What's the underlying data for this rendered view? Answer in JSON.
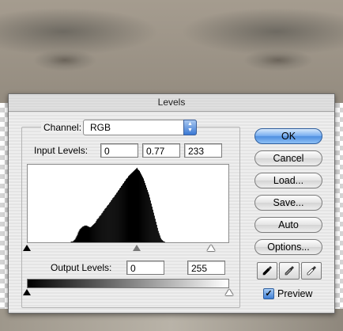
{
  "dialog": {
    "title": "Levels",
    "channel_label": "Channel:",
    "channel_value": "RGB",
    "input_levels_label": "Input Levels:",
    "input_black": "0",
    "input_gamma": "0.77",
    "input_white": "233",
    "output_levels_label": "Output Levels:",
    "output_black": "0",
    "output_white": "255",
    "preview_label": "Preview",
    "preview_checked": true
  },
  "buttons": {
    "ok": "OK",
    "cancel": "Cancel",
    "load": "Load...",
    "save": "Save...",
    "auto": "Auto",
    "options": "Options..."
  },
  "histogram": {
    "levels": [
      0,
      0,
      0,
      0,
      0,
      0,
      0,
      0,
      0,
      0,
      0,
      0,
      0,
      0,
      0,
      0,
      0,
      0,
      0,
      0,
      0,
      0,
      0,
      0,
      0,
      0,
      0,
      0,
      0,
      0,
      0,
      0,
      0,
      0,
      0,
      0,
      0,
      0,
      0,
      0,
      0,
      0,
      0,
      0,
      0,
      0,
      0,
      0,
      0,
      0,
      0,
      0,
      0,
      0,
      0,
      1,
      1,
      1,
      2,
      3,
      4,
      6,
      8,
      10,
      13,
      15,
      17,
      18,
      19,
      20,
      21,
      21,
      22,
      22,
      22,
      22,
      21,
      21,
      20,
      20,
      20,
      21,
      22,
      23,
      24,
      25,
      26,
      28,
      30,
      31,
      32,
      34,
      35,
      36,
      38,
      39,
      41,
      42,
      44,
      45,
      46,
      48,
      49,
      50,
      52,
      53,
      55,
      56,
      58,
      59,
      60,
      62,
      63,
      65,
      66,
      68,
      69,
      71,
      72,
      74,
      75,
      77,
      78,
      80,
      81,
      83,
      84,
      85,
      87,
      88,
      89,
      90,
      91,
      92,
      93,
      94,
      95,
      96,
      97,
      98,
      96,
      95,
      94,
      92,
      90,
      88,
      86,
      84,
      81,
      78,
      75,
      72,
      69,
      66,
      63,
      59,
      55,
      51,
      47,
      43,
      39,
      35,
      31,
      27,
      23,
      19,
      15,
      12,
      9,
      6,
      4,
      3,
      2,
      1,
      1,
      0,
      0,
      0,
      0,
      0,
      0,
      0,
      0,
      0,
      0,
      0,
      0,
      0,
      0,
      0,
      0,
      0,
      0,
      0,
      0,
      0,
      0,
      0,
      0,
      0,
      0,
      0,
      0,
      0,
      0,
      0,
      0,
      0,
      0,
      0,
      0,
      0,
      0,
      0,
      0,
      0,
      0,
      0,
      0,
      0,
      0,
      0,
      0,
      0,
      0,
      0,
      0,
      0,
      0,
      0,
      0,
      0,
      0,
      0,
      0,
      0,
      0,
      0,
      0,
      0,
      0,
      0,
      0,
      0,
      0,
      0,
      0,
      0,
      0,
      0,
      0,
      0,
      0,
      0,
      0,
      0,
      0,
      0,
      0,
      0,
      0,
      0,
      0,
      0,
      0,
      0,
      0,
      0,
      0,
      0,
      0,
      0,
      0,
      0,
      0,
      0,
      0,
      0,
      0,
      0
    ]
  },
  "icons": {
    "eyedroppers": [
      "black-eyedropper-icon",
      "gray-eyedropper-icon",
      "white-eyedropper-icon"
    ],
    "channel_arrows": "updown-arrows-icon"
  },
  "colors": {
    "accent": "#4f8fe0",
    "dialog_bg": "#eeeeee"
  }
}
